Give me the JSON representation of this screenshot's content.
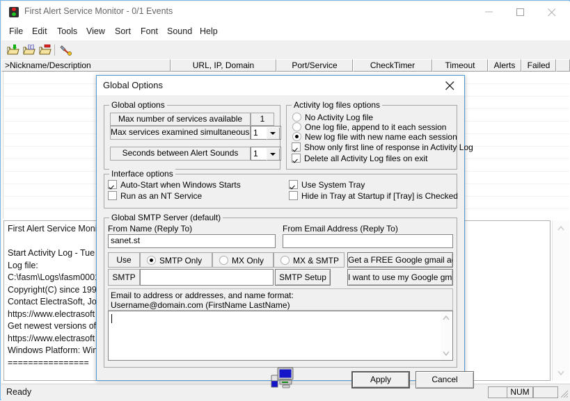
{
  "window": {
    "title": "First Alert Service Monitor - 0/1 Events",
    "icon": "traffic-light-icon",
    "controls": {
      "minimize": "–",
      "maximize": "□",
      "close": "✕"
    }
  },
  "menubar": {
    "items": [
      "File",
      "Edit",
      "Tools",
      "View",
      "Sort",
      "Font",
      "Sound",
      "Help"
    ]
  },
  "toolbar": {
    "buttons": [
      {
        "name": "open-add-folder-icon",
        "tip": "New"
      },
      {
        "name": "open-edit-folder-icon",
        "tip": "Edit"
      },
      {
        "name": "open-delete-folder-icon",
        "tip": "Delete"
      },
      {
        "name": "tools-hammer-icon",
        "tip": "Tools"
      }
    ]
  },
  "list": {
    "columns": [
      {
        "label": ">Nickname/Description",
        "align": "left"
      },
      {
        "label": "URL, IP, Domain",
        "align": "center"
      },
      {
        "label": "Port/Service",
        "align": "center"
      },
      {
        "label": "CheckTimer",
        "align": "center"
      },
      {
        "label": "Timeout",
        "align": "center"
      },
      {
        "label": "Alerts",
        "align": "center"
      },
      {
        "label": "Failed",
        "align": "center"
      },
      {
        "label": "",
        "align": "center"
      }
    ],
    "rows": []
  },
  "log": {
    "lines": "First Alert Service Monit\n\nStart Activity Log - Tue \nLog file:\nC:\\fasm\\Logs\\fasm0001\nCopyright(C) since 1990\nContact ElectraSoft, Jon\nhttps://www.electrasoft\nGet newest versions of t\nhttps://www.electrasoft\nWindows Platform: Win\n================"
  },
  "statusbar": {
    "text": "Ready",
    "panes": [
      "",
      "NUM",
      ""
    ]
  },
  "dialog": {
    "title": "Global Options",
    "close_label": "✕",
    "global_options": {
      "legend": "Global options",
      "max_services_available_label": "Max number of services available",
      "max_services_available_value": "1",
      "max_simultaneous_label": "Max services examined simultaneously",
      "max_simultaneous_value": "1",
      "seconds_between_alerts_label": "Seconds between Alert Sounds",
      "seconds_between_alerts_value": "1"
    },
    "activity_log": {
      "legend": "Activity log files options",
      "radios": [
        {
          "label": "No Activity Log file",
          "selected": false
        },
        {
          "label": "One log file, append to it each session",
          "selected": false
        },
        {
          "label": "New log file with new name each session",
          "selected": true
        }
      ],
      "checks": [
        {
          "label": "Show only first line of response in Activity Log",
          "checked": true
        },
        {
          "label": "Delete all Activity Log files on exit",
          "checked": true
        }
      ]
    },
    "interface_options": {
      "legend": "Interface options",
      "checks_left": [
        {
          "label": "Auto-Start when Windows Starts",
          "checked": true
        },
        {
          "label": "Run as an NT Service",
          "checked": false
        }
      ],
      "checks_right": [
        {
          "label": "Use System Tray",
          "checked": true
        },
        {
          "label": "Hide in Tray at Startup if [Tray] is Checked",
          "checked": false
        }
      ]
    },
    "smtp": {
      "legend": "Global SMTP Server (default)",
      "from_name_label": "From Name (Reply To)",
      "from_name_value": "sanet.st",
      "from_email_label": "From Email Address (Reply To)",
      "from_email_value": "",
      "use_label": "Use",
      "use_options": [
        {
          "label": "SMTP Only",
          "selected": true
        },
        {
          "label": "MX Only",
          "selected": false
        },
        {
          "label": "MX & SMTP",
          "selected": false
        }
      ],
      "smtp_label": "SMTP",
      "smtp_value": "",
      "smtp_setup_button": "SMTP Setup",
      "gmail_free_button": "Get a FREE Google gmail account",
      "gmail_use_button": "I want to use my Google gmail account",
      "email_to_help": "Email to address or addresses, and name format:\nUsername@domain.com (FirstName LastName)",
      "email_to_value": ""
    },
    "footer": {
      "icon": "computer-monitor-icon",
      "apply_label": "Apply",
      "cancel_label": "Cancel"
    }
  },
  "colors": {
    "window_border": "#7ab8e8",
    "dialog_border": "#4f9ad7",
    "face": "#f0f0f0",
    "field": "#ffffff",
    "text": "#000000",
    "title_text": "#666666"
  }
}
